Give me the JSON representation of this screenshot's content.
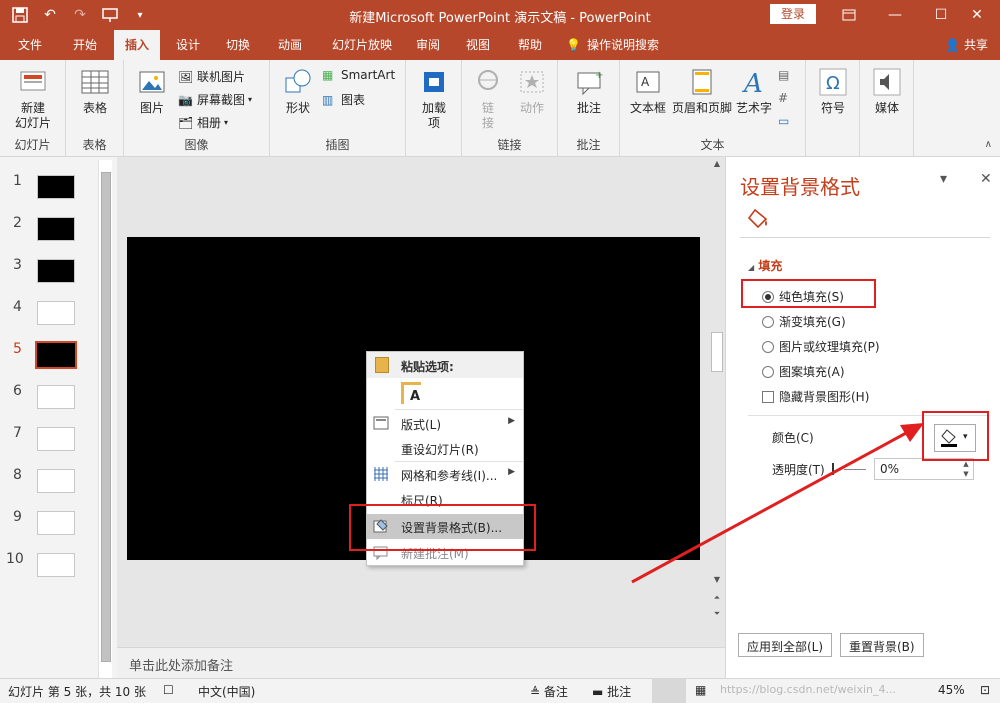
{
  "titlebar": {
    "title": "新建Microsoft PowerPoint 演示文稿  -  PowerPoint",
    "login": "登录",
    "save_icon": "save-icon",
    "undo_icon": "undo-icon",
    "redo_icon": "redo-icon"
  },
  "tabs": [
    "文件",
    "开始",
    "插入",
    "设计",
    "切换",
    "动画",
    "幻灯片放映",
    "审阅",
    "视图",
    "帮助"
  ],
  "tell_me": "操作说明搜索",
  "share": "共享",
  "ribbon": {
    "new_slide": "新建\n幻灯片",
    "group_slides": "幻灯片",
    "table": "表格",
    "group_table": "表格",
    "picture": "图片",
    "online_picture": "联机图片",
    "screenshot": "屏幕截图",
    "album": "相册",
    "group_images": "图像",
    "shapes": "形状",
    "smartart": "SmartArt",
    "chart": "图表",
    "group_illustrations": "插图",
    "addins": "加载\n项",
    "link": "链\n接",
    "action": "动作",
    "group_links": "链接",
    "comment": "批注",
    "group_comments": "批注",
    "textbox": "文本框",
    "header_footer": "页眉和页脚",
    "wordart": "艺术字",
    "group_text": "文本",
    "symbol": "符号",
    "media": "媒体"
  },
  "slides": [
    "1",
    "2",
    "3",
    "4",
    "5",
    "6",
    "7",
    "8",
    "9",
    "10"
  ],
  "notes_placeholder": "单击此处添加备注",
  "context_menu": {
    "paste_header": "粘贴选项:",
    "layout": "版式(L)",
    "reset": "重设幻灯片(R)",
    "grid": "网格和参考线(I)...",
    "ruler": "标尺(R)",
    "format_bg": "设置背景格式(B)...",
    "new_comment": "新建批注(M)"
  },
  "pane": {
    "title": "设置背景格式",
    "fill_header": "填充",
    "solid": "纯色填充(S)",
    "gradient": "渐变填充(G)",
    "picture_texture": "图片或纹理填充(P)",
    "pattern": "图案填充(A)",
    "hide_bg": "隐藏背景图形(H)",
    "color_label": "颜色(C)",
    "transparency_label": "透明度(T)",
    "transparency_value": "0%",
    "apply_all": "应用到全部(L)",
    "reset_bg": "重置背景(B)"
  },
  "status": {
    "slide_info": "幻灯片 第 5 张，共 10 张",
    "language": "中文(中国)",
    "notes": "备注",
    "comments": "批注",
    "zoom": "45%",
    "watermark": "https://blog.csdn.net/weixin_4..."
  }
}
